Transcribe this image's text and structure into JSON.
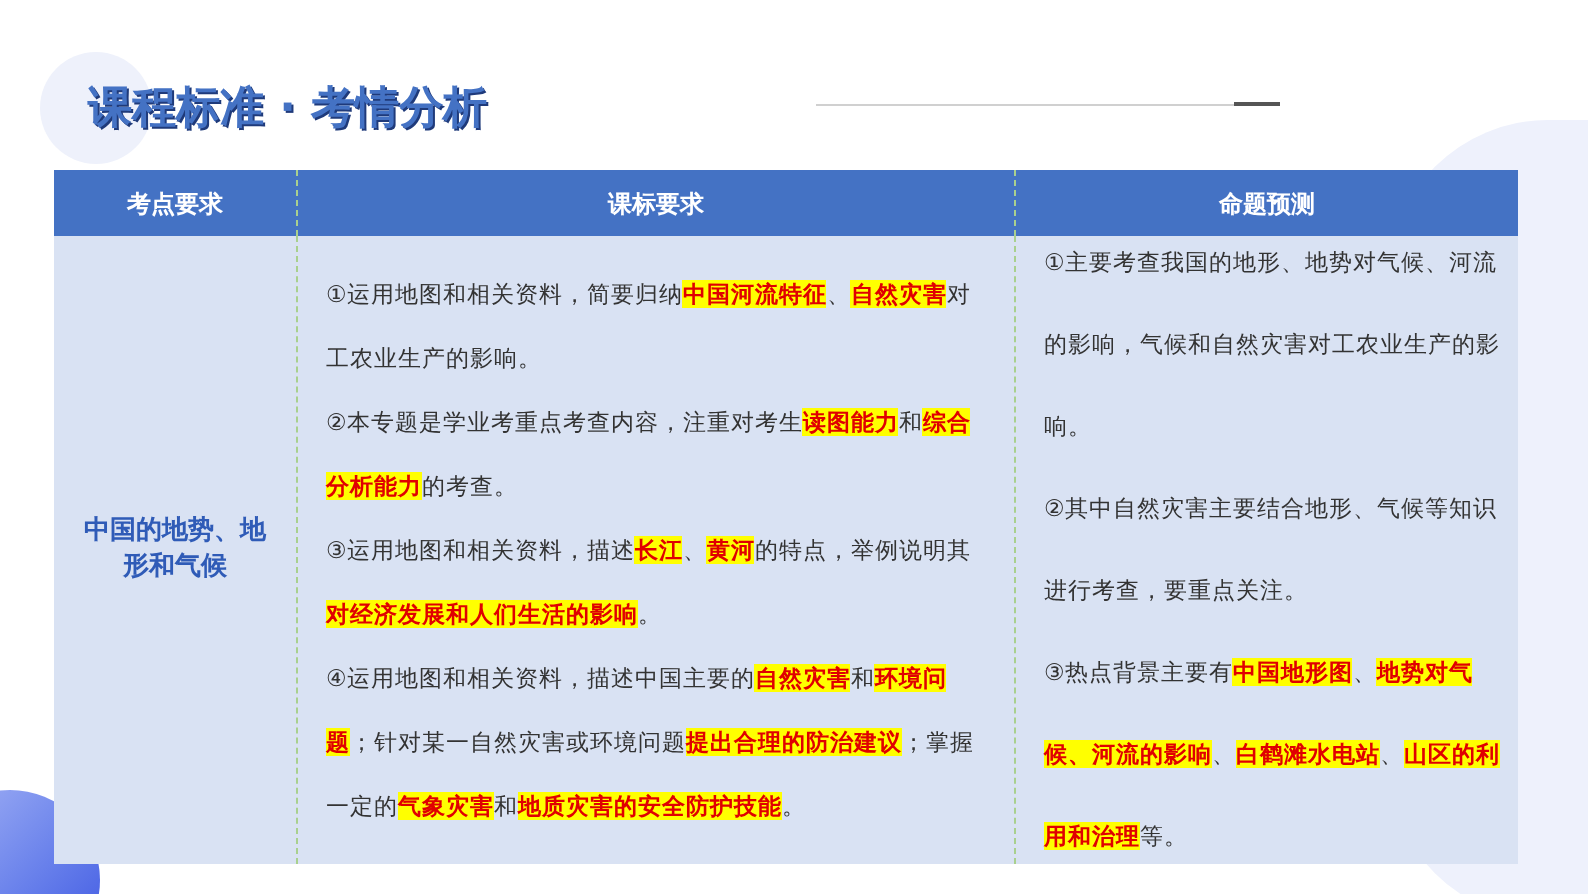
{
  "title": "课程标准 · 考情分析",
  "table": {
    "columns": [
      "考点要求",
      "课标要求",
      "命题预测"
    ],
    "rows": [
      {
        "topic": "中国的地势、地形和气候",
        "requirements": [
          "①运用地图和相关资料，简要归纳**中国河流特征**、**自然灾害**对工农业生产的影响。",
          "②本专题是学业考重点考查内容，注重对考生**读图能力**和**综合分析能力**的考查。",
          "③运用地图和相关资料，描述**长江**、**黄河**的特点，举例说明其**对经济发展和人们生活的影响**。",
          "④运用地图和相关资料，描述中国主要的**自然灾害**和**环境问题**；针对某一自然灾害或环境问题**提出合理的防治建议**；掌握一定的**气象灾害**和**地质灾害的安全防护技能**。"
        ],
        "predictions": [
          "①主要考查我国的地形、地势对气候、河流的影响，气候和自然灾害对工农业生产的影响。",
          "②其中自然灾害主要结合地形、气候等知识进行考查，要重点关注。",
          "③热点背景主要有**中国地形图**、**地势对气候、河流的影响**、**白鹤滩水电站**、**山区的利用和治理**等。"
        ]
      }
    ]
  }
}
